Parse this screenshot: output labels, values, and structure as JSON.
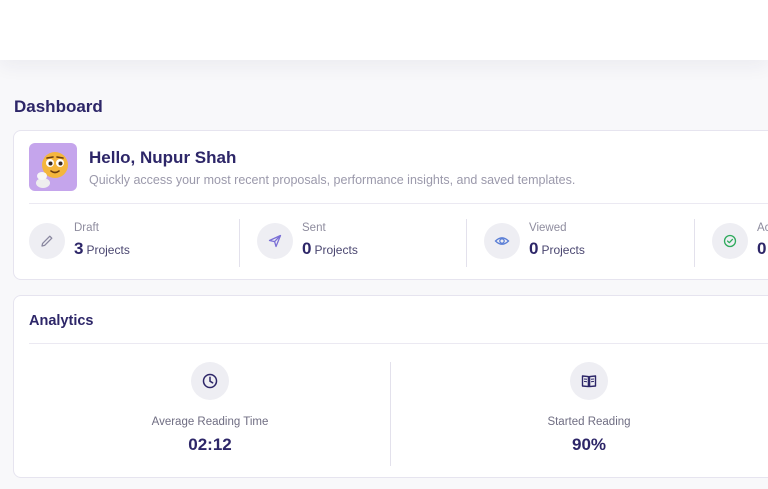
{
  "page": {
    "title": "Dashboard"
  },
  "welcome": {
    "greeting": "Hello, Nupur Shah",
    "subtitle": "Quickly access your most recent proposals, performance insights, and saved templates."
  },
  "stats": [
    {
      "label": "Draft",
      "count": "3",
      "unit": "Projects",
      "icon": "pencil-icon",
      "color": "#8a88a0"
    },
    {
      "label": "Sent",
      "count": "0",
      "unit": "Projects",
      "icon": "paper-plane-icon",
      "color": "#7a6fd6"
    },
    {
      "label": "Viewed",
      "count": "0",
      "unit": "Projects",
      "icon": "eye-icon",
      "color": "#5b7fd6"
    },
    {
      "label": "Ac",
      "count": "0",
      "unit": "",
      "icon": "check-circle-icon",
      "color": "#2eaa5c"
    }
  ],
  "analytics": {
    "title": "Analytics",
    "metrics": [
      {
        "label": "Average Reading Time",
        "value": "02:12",
        "icon": "clock-icon"
      },
      {
        "label": "Started Reading",
        "value": "90%",
        "icon": "book-icon"
      }
    ]
  },
  "colors": {
    "brand": "#2d2668",
    "avatar_bg": "#c5a5ec",
    "icon_bg": "#eeeef3"
  }
}
